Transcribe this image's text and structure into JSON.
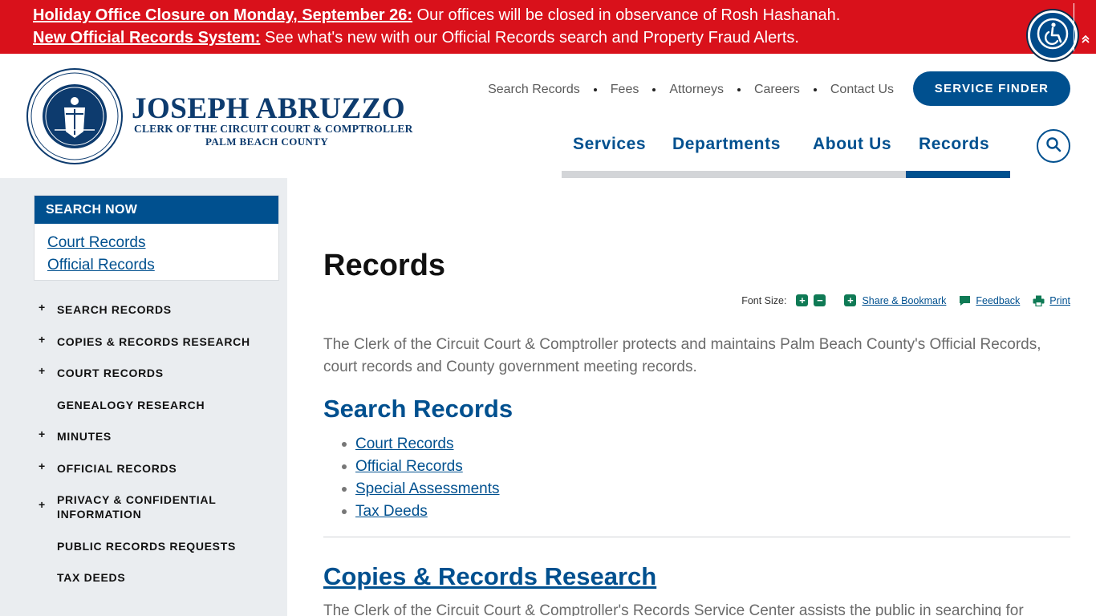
{
  "alerts": [
    {
      "link": "Holiday Office Closure on Monday, September 26:",
      "text": " Our offices will be closed in observance of Rosh Hashanah."
    },
    {
      "link": "New Official Records System:",
      "text": " See what's new with our Official Records search and Property Fraud Alerts."
    }
  ],
  "header": {
    "name": "JOSEPH ABRUZZO",
    "subtitle1": "CLERK OF THE CIRCUIT COURT & COMPTROLLER",
    "subtitle2": "PALM BEACH COUNTY",
    "seal_text": "CLERK OF THE CIRCUIT COURT & COMPTROLLER · PALM BEACH COUNTY",
    "util_nav": [
      "Search Records",
      "Fees",
      "Attorneys",
      "Careers",
      "Contact Us"
    ],
    "service_finder": "SERVICE FINDER",
    "main_nav": [
      "Services",
      "Departments",
      "About Us",
      "Records"
    ],
    "active_nav": "Records"
  },
  "sidebar": {
    "search_now": {
      "title": "SEARCH NOW",
      "links": [
        "Court Records",
        "Official Records"
      ]
    },
    "items": [
      {
        "label": "SEARCH RECORDS",
        "expandable": "+"
      },
      {
        "label": "COPIES & RECORDS RESEARCH",
        "expandable": "+"
      },
      {
        "label": "COURT RECORDS",
        "expandable": "+"
      },
      {
        "label": "GENEALOGY RESEARCH",
        "expandable": ""
      },
      {
        "label": "MINUTES",
        "expandable": "+"
      },
      {
        "label": "OFFICIAL RECORDS",
        "expandable": "+"
      },
      {
        "label": "PRIVACY & CONFIDENTIAL INFORMATION",
        "expandable": "+"
      },
      {
        "label": "PUBLIC RECORDS REQUESTS",
        "expandable": ""
      },
      {
        "label": "TAX DEEDS",
        "expandable": ""
      }
    ]
  },
  "content": {
    "title": "Records",
    "tools": {
      "font_size": "Font Size:",
      "increase": "+",
      "decrease": "−",
      "share": "Share & Bookmark",
      "feedback": "Feedback",
      "print": "Print"
    },
    "intro": "The Clerk of the Circuit Court & Comptroller protects and maintains Palm Beach County's Official Records, court records and County government meeting records.",
    "search_records": {
      "heading": "Search Records",
      "links": [
        "Court Records",
        "Official Records",
        "Special Assessments",
        "Tax Deeds"
      ]
    },
    "copies": {
      "heading": "Copies & Records Research",
      "text": "The Clerk of the Circuit Court & Comptroller's Records Service Center assists the public in searching for"
    }
  },
  "colors": {
    "alert_red": "#d9111b",
    "brand_blue": "#00508f",
    "navy": "#0d3b6e",
    "sidebar_bg": "#eaedf0",
    "tool_green": "#0f7a55"
  }
}
